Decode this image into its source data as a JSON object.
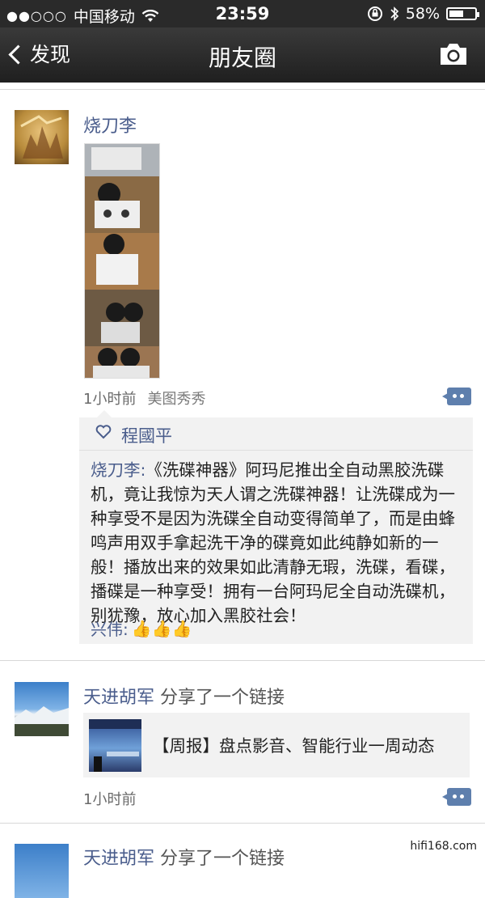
{
  "status_bar": {
    "carrier": "中国移动",
    "time": "23:59",
    "battery": "58%",
    "battery_level": 0.58
  },
  "nav": {
    "back_label": "发现",
    "title": "朋友圈"
  },
  "posts": [
    {
      "author": "烧刀李",
      "time": "1小时前",
      "source": "美图秀秀",
      "likes": {
        "names": "程國平"
      },
      "comments": [
        {
          "author": "烧刀李:",
          "text": "《洗碟神器》阿玛尼推出全自动黑胶洗碟机，竟让我惊为天人谓之洗碟神器！让洗碟成为一种享受不是因为洗碟全自动变得简单了，而是由蜂鸣声用双手拿起洗干净的碟竟如此纯静如新的一般！播放出来的效果如此清静无瑕，洗碟，看碟，播碟是一种享受！拥有一台阿玛尼全自动洗碟机，别犹豫，放心加入黑胶社会！"
        },
        {
          "author": "兴伟:",
          "text": "👍👍👍"
        }
      ]
    },
    {
      "author": "天进胡军",
      "action": "分享了一个链接",
      "link_title": "【周报】盘点影音、智能行业一周动态",
      "time": "1小时前"
    },
    {
      "author": "天进胡军",
      "action": "分享了一个链接"
    }
  ],
  "watermark": "hifi168.com"
}
